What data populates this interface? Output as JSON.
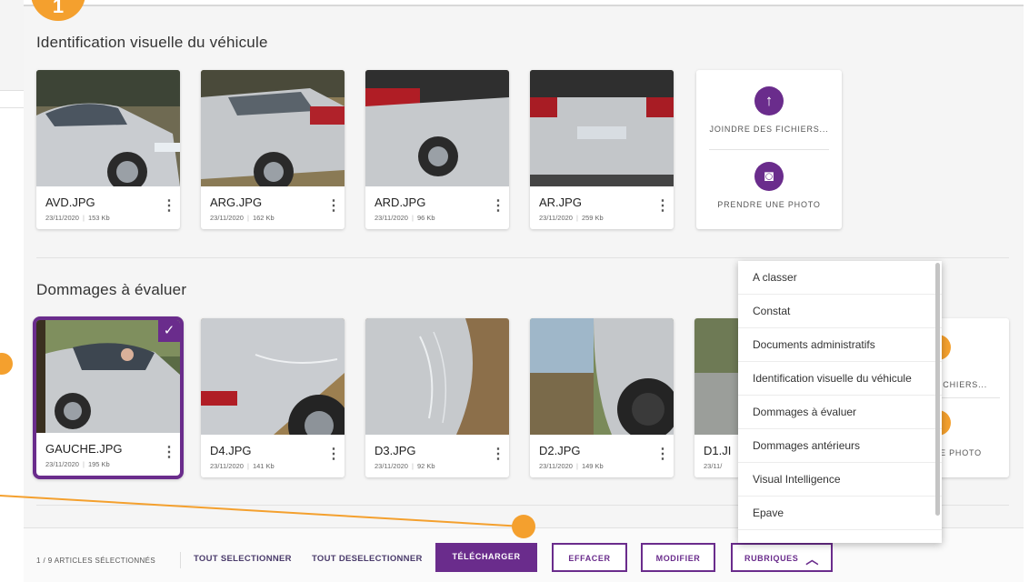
{
  "callout": {
    "badge": "1"
  },
  "sections": [
    {
      "title": "Identification visuelle du véhicule",
      "cards": [
        {
          "name": "AVD.JPG",
          "date": "23/11/2020",
          "size": "153 Kb",
          "selected": false
        },
        {
          "name": "ARG.JPG",
          "date": "23/11/2020",
          "size": "162 Kb",
          "selected": false
        },
        {
          "name": "ARD.JPG",
          "date": "23/11/2020",
          "size": "96 Kb",
          "selected": false
        },
        {
          "name": "AR.JPG",
          "date": "23/11/2020",
          "size": "259 Kb",
          "selected": false
        }
      ],
      "upload": {
        "attach_label": "JOINDRE DES FICHIERS...",
        "photo_label": "PRENDRE UNE PHOTO"
      }
    },
    {
      "title": "Dommages à évaluer",
      "cards": [
        {
          "name": "GAUCHE.JPG",
          "date": "23/11/2020",
          "size": "195 Kb",
          "selected": true
        },
        {
          "name": "D4.JPG",
          "date": "23/11/2020",
          "size": "141 Kb",
          "selected": false
        },
        {
          "name": "D3.JPG",
          "date": "23/11/2020",
          "size": "92 Kb",
          "selected": false
        },
        {
          "name": "D2.JPG",
          "date": "23/11/2020",
          "size": "149 Kb",
          "selected": false
        },
        {
          "name": "D1.JI",
          "date": "23/11/",
          "size": "",
          "selected": false
        }
      ],
      "upload": {
        "attach_label": "ICHIERS...",
        "photo_label": "E PHOTO"
      }
    }
  ],
  "dropdown": {
    "items": [
      "A classer",
      "Constat",
      "Documents administratifs",
      "Identification visuelle du véhicule",
      "Dommages à évaluer",
      "Dommages antérieurs",
      "Visual Intelligence",
      "Epave"
    ]
  },
  "bottom_bar": {
    "selection_count": "1 / 9 ARTICLES SÉLECTIONNÉS",
    "select_all": "TOUT SELECTIONNER",
    "deselect_all": "TOUT DESELECTIONNER",
    "download": "TÉLÉCHARGER",
    "delete": "EFFACER",
    "modify": "MODIFIER",
    "categories": "RUBRIQUES"
  },
  "icons": {
    "upload": "arrow-up-icon",
    "camera": "camera-icon",
    "kebab": "more-vertical-icon",
    "check": "check-icon",
    "chevron": "chevron-up-icon"
  },
  "colors": {
    "accent": "#6a2c8c",
    "callout": "#f4a02e",
    "background": "#f5f5f5"
  }
}
